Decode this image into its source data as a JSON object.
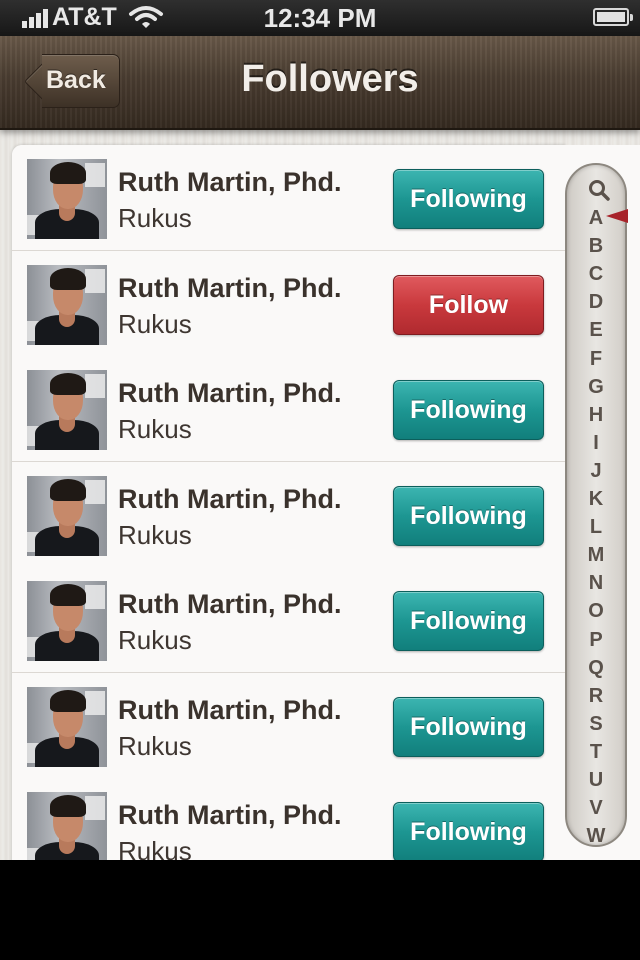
{
  "status_bar": {
    "carrier": "AT&T",
    "time": "12:34 PM",
    "signal_icon": "signal-bars-icon",
    "wifi_icon": "wifi-icon",
    "battery_icon": "battery-icon"
  },
  "nav_bar": {
    "back_label": "Back",
    "title": "Followers"
  },
  "colors": {
    "following_button": "#1d9692",
    "follow_button": "#c9393d",
    "nav_bar": "#4a3d31",
    "index_marker": "#a8232a"
  },
  "followers": [
    {
      "name": "Ruth Martin, Phd.",
      "handle": "Rukus",
      "button_label": "Following",
      "button_state": "following"
    },
    {
      "name": "Ruth Martin, Phd.",
      "handle": "Rukus",
      "button_label": "Follow",
      "button_state": "follow"
    },
    {
      "name": "Ruth Martin, Phd.",
      "handle": "Rukus",
      "button_label": "Following",
      "button_state": "following"
    },
    {
      "name": "Ruth Martin, Phd.",
      "handle": "Rukus",
      "button_label": "Following",
      "button_state": "following"
    },
    {
      "name": "Ruth Martin, Phd.",
      "handle": "Rukus",
      "button_label": "Following",
      "button_state": "following"
    },
    {
      "name": "Ruth Martin, Phd.",
      "handle": "Rukus",
      "button_label": "Following",
      "button_state": "following"
    },
    {
      "name": "Ruth Martin, Phd.",
      "handle": "Rukus",
      "button_label": "Following",
      "button_state": "following"
    }
  ],
  "alphabet_index": {
    "search_icon": "search-icon",
    "letters": [
      "A",
      "B",
      "C",
      "D",
      "E",
      "F",
      "G",
      "H",
      "I",
      "J",
      "K",
      "L",
      "M",
      "N",
      "O",
      "P",
      "Q",
      "R",
      "S",
      "T",
      "U",
      "V",
      "W"
    ],
    "selected_letter": "A"
  }
}
